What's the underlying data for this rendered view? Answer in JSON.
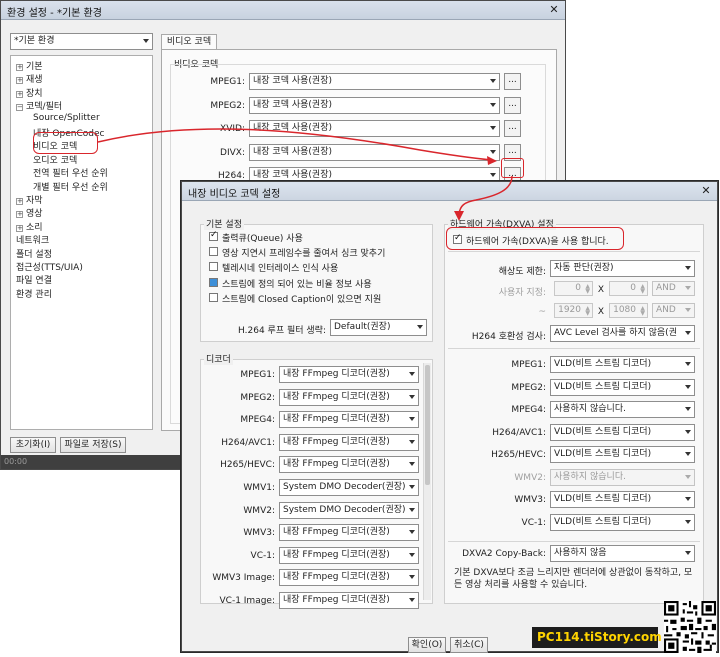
{
  "bg_window": {
    "title": "환경 설정 - *기본 환경",
    "profile_select": "*기본 환경",
    "tree": [
      {
        "label": "기본",
        "expander": "+",
        "level": 0
      },
      {
        "label": "재생",
        "expander": "+",
        "level": 0
      },
      {
        "label": "장치",
        "expander": "+",
        "level": 0
      },
      {
        "label": "코덱/필터",
        "expander": "−",
        "level": 0
      },
      {
        "label": "Source/Splitter",
        "expander": "",
        "level": 1
      },
      {
        "label": "내장 OpenCodec",
        "expander": "",
        "level": 1
      },
      {
        "label": "비디오 코덱",
        "expander": "",
        "level": 1
      },
      {
        "label": "오디오 코덱",
        "expander": "",
        "level": 1
      },
      {
        "label": "전역 필터 우선 순위",
        "expander": "",
        "level": 1
      },
      {
        "label": "개별 필터 우선 순위",
        "expander": "",
        "level": 1
      },
      {
        "label": "자막",
        "expander": "+",
        "level": 0
      },
      {
        "label": "영상",
        "expander": "+",
        "level": 0
      },
      {
        "label": "소리",
        "expander": "+",
        "level": 0
      },
      {
        "label": "네트워크",
        "expander": "",
        "level": 0
      },
      {
        "label": "폴더 설정",
        "expander": "",
        "level": 0
      },
      {
        "label": "접근성(TTS/UIA)",
        "expander": "",
        "level": 0
      },
      {
        "label": "파일 연결",
        "expander": "",
        "level": 0
      },
      {
        "label": "환경 관리",
        "expander": "",
        "level": 0
      }
    ],
    "tab": "비디오 코덱",
    "group_title": "비디오 코덱",
    "codecs": [
      {
        "label": "MPEG1:",
        "value": "내장 코덱 사용(권장)"
      },
      {
        "label": "MPEG2:",
        "value": "내장 코덱 사용(권장)"
      },
      {
        "label": "XVID:",
        "value": "내장 코덱 사용(권장)"
      },
      {
        "label": "DIVX:",
        "value": "내장 코덱 사용(권장)"
      },
      {
        "label": "H264:",
        "value": "내장 코덱 사용(권장)"
      }
    ],
    "dots_label": "...",
    "reset_button": "초기화(I)",
    "save_button": "파일로 저장(S)",
    "status": "00:00"
  },
  "dialog": {
    "title": "내장 비디오 코덱 설정",
    "close": "✕",
    "basic_title": "기본 설정",
    "checkboxes": [
      {
        "label": "출력큐(Queue) 사용",
        "state": "checked"
      },
      {
        "label": "영상 지연시 프레임수를 줄여서 싱크 맞추기",
        "state": "unchecked"
      },
      {
        "label": "텔레시네 인터레이스 인식 사용",
        "state": "unchecked"
      },
      {
        "label": "스트림에 정의 되어 있는 비율 정보 사용",
        "state": "partial"
      },
      {
        "label": "스트림에 Closed Caption이 있으면 지원",
        "state": "unchecked"
      }
    ],
    "loop_filter_label": "H.264 루프 필터 생략:",
    "loop_filter_value": "Default(권장)",
    "decoder_title": "디코더",
    "decoders": [
      {
        "label": "MPEG1:",
        "value": "내장 FFmpeg 디코더(권장)"
      },
      {
        "label": "MPEG2:",
        "value": "내장 FFmpeg 디코더(권장)"
      },
      {
        "label": "MPEG4:",
        "value": "내장 FFmpeg 디코더(권장)"
      },
      {
        "label": "H264/AVC1:",
        "value": "내장 FFmpeg 디코더(권장)"
      },
      {
        "label": "H265/HEVC:",
        "value": "내장 FFmpeg 디코더(권장)"
      },
      {
        "label": "WMV1:",
        "value": "System DMO Decoder(권장)"
      },
      {
        "label": "WMV2:",
        "value": "System DMO Decoder(권장)"
      },
      {
        "label": "WMV3:",
        "value": "내장 FFmpeg 디코더(권장)"
      },
      {
        "label": "VC-1:",
        "value": "내장 FFmpeg 디코더(권장)"
      },
      {
        "label": "WMV3 Image:",
        "value": "내장 FFmpeg 디코더(권장)"
      },
      {
        "label": "VC-1 Image:",
        "value": "내장 FFmpeg 디코더(권장)"
      }
    ],
    "hw_title": "하드웨어 가속(DXVA) 설정",
    "hw_checkbox": "하드웨어 가속(DXVA)을 사용 합니다.",
    "resolution_label": "해상도 제한:",
    "resolution_value": "자동 판단(권장)",
    "user_specified_label": "사용자 지정:",
    "spin_min_w": "0",
    "spin_min_h": "0",
    "spin_max_w": "1920",
    "spin_max_h": "1080",
    "x_sep": "X",
    "tilde": "~",
    "and_label": "AND",
    "h264_compat_label": "H264 호환성 검사:",
    "h264_compat_value": "AVC Level 검사를 하지 않음(권",
    "hw_codecs": [
      {
        "label": "MPEG1:",
        "value": "VLD(비트 스트림 디코더)",
        "disabled": false
      },
      {
        "label": "MPEG2:",
        "value": "VLD(비트 스트림 디코더)",
        "disabled": false
      },
      {
        "label": "MPEG4:",
        "value": "사용하지 않습니다.",
        "disabled": false
      },
      {
        "label": "H264/AVC1:",
        "value": "VLD(비트 스트림 디코더)",
        "disabled": false
      },
      {
        "label": "H265/HEVC:",
        "value": "VLD(비트 스트림 디코더)",
        "disabled": false
      },
      {
        "label": "WMV2:",
        "value": "사용하지 않습니다.",
        "disabled": true
      },
      {
        "label": "WMV3:",
        "value": "VLD(비트 스트림 디코더)",
        "disabled": false
      },
      {
        "label": "VC-1:",
        "value": "VLD(비트 스트림 디코더)",
        "disabled": false
      }
    ],
    "copyback_label": "DXVA2 Copy-Back:",
    "copyback_value": "사용하지 않음",
    "note": "기본 DXVA보다 조금 느리지만 렌더러에 상관없이 동작하고, 모든 영상 처리를 사용할 수 있습니다.",
    "ok_button": "확인(O)",
    "cancel_button": "취소(C)"
  },
  "watermark": "PC114.tiStory.com",
  "colors": {
    "highlight": "#d9262c",
    "watermark_bg": "#1d1d1d",
    "watermark_text": "#ffd400",
    "watermark_accent": "#f3a30f"
  }
}
